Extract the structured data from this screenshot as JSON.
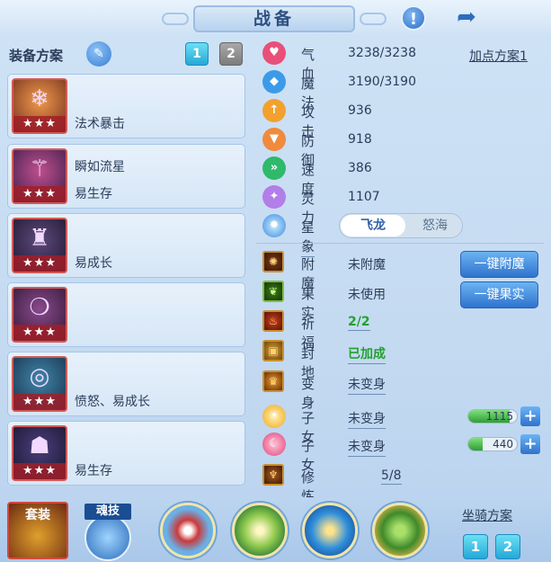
{
  "title": "战备",
  "icons": {
    "warning": "exclamation-icon",
    "share": "share-icon"
  },
  "equip": {
    "header": "装备方案",
    "plans": [
      "1",
      "2"
    ],
    "slots": [
      {
        "icon": "ice-pop-icon",
        "stars": "★★★",
        "line1": "",
        "line2": "法术暴击"
      },
      {
        "icon": "staff-icon",
        "stars": "★★★",
        "line1": "瞬如流星",
        "line2": "易生存"
      },
      {
        "icon": "armor-icon",
        "stars": "★★★",
        "line1": "",
        "line2": "易成长"
      },
      {
        "icon": "necklace-icon",
        "stars": "★★★",
        "line1": "",
        "line2": ""
      },
      {
        "icon": "belt-icon",
        "stars": "★★★",
        "line1": "",
        "line2": "愤怒、易成长"
      },
      {
        "icon": "boots-icon",
        "stars": "★★★",
        "line1": "",
        "line2": "易生存"
      }
    ]
  },
  "stats": {
    "plan_link": "加点方案1",
    "items": [
      {
        "label": "气血",
        "value": "3238/3238",
        "color": "#e8507a",
        "glyph": "♥"
      },
      {
        "label": "魔法",
        "value": "3190/3190",
        "color": "#3c9be8",
        "glyph": "◆"
      },
      {
        "label": "攻击",
        "value": "936",
        "color": "#f2a12f",
        "glyph": "↑"
      },
      {
        "label": "防御",
        "value": "918",
        "color": "#f08a3c",
        "glyph": "▼"
      },
      {
        "label": "速度",
        "value": "386",
        "color": "#2fb96b",
        "glyph": "»"
      },
      {
        "label": "灵力",
        "value": "1107",
        "color": "#b27ee8",
        "glyph": "✦"
      }
    ],
    "star_label": "星象",
    "star_options": [
      "飞龙",
      "怒海"
    ]
  },
  "enhance": [
    {
      "label": "附魔",
      "value": "未附魔",
      "icon": "enchant-icon",
      "glyph": "✺"
    },
    {
      "label": "果实",
      "value": "未使用",
      "icon": "fruit-icon",
      "glyph": "❦"
    },
    {
      "label": "祈福",
      "value": "2/2",
      "icon": "blessing-icon",
      "glyph": "♨"
    },
    {
      "label": "封地",
      "value": "已加成",
      "icon": "territory-icon",
      "glyph": "▣"
    },
    {
      "label": "变身",
      "value": "未变身",
      "icon": "transform-icon",
      "glyph": "♛"
    },
    {
      "label": "子女",
      "value": "未变身",
      "icon": "child-sun-icon",
      "glyph": "☀"
    },
    {
      "label": "子女",
      "value": "未变身",
      "icon": "child-moon-icon",
      "glyph": "☾"
    },
    {
      "label": "修炼觉醒",
      "value": "5/8",
      "icon": "cultivation-icon",
      "glyph": "♆"
    }
  ],
  "actions": {
    "enchant_all": "一键附魔",
    "fruit_all": "一键果实"
  },
  "child_bars": [
    {
      "value": "1115",
      "fill": 0.85
    },
    {
      "value": "440",
      "fill": 0.3
    }
  ],
  "bottom": {
    "set_label": "套装",
    "skill_label": "魂技",
    "mount_title": "坐骑方案",
    "mount_plans": [
      "1",
      "2"
    ]
  }
}
